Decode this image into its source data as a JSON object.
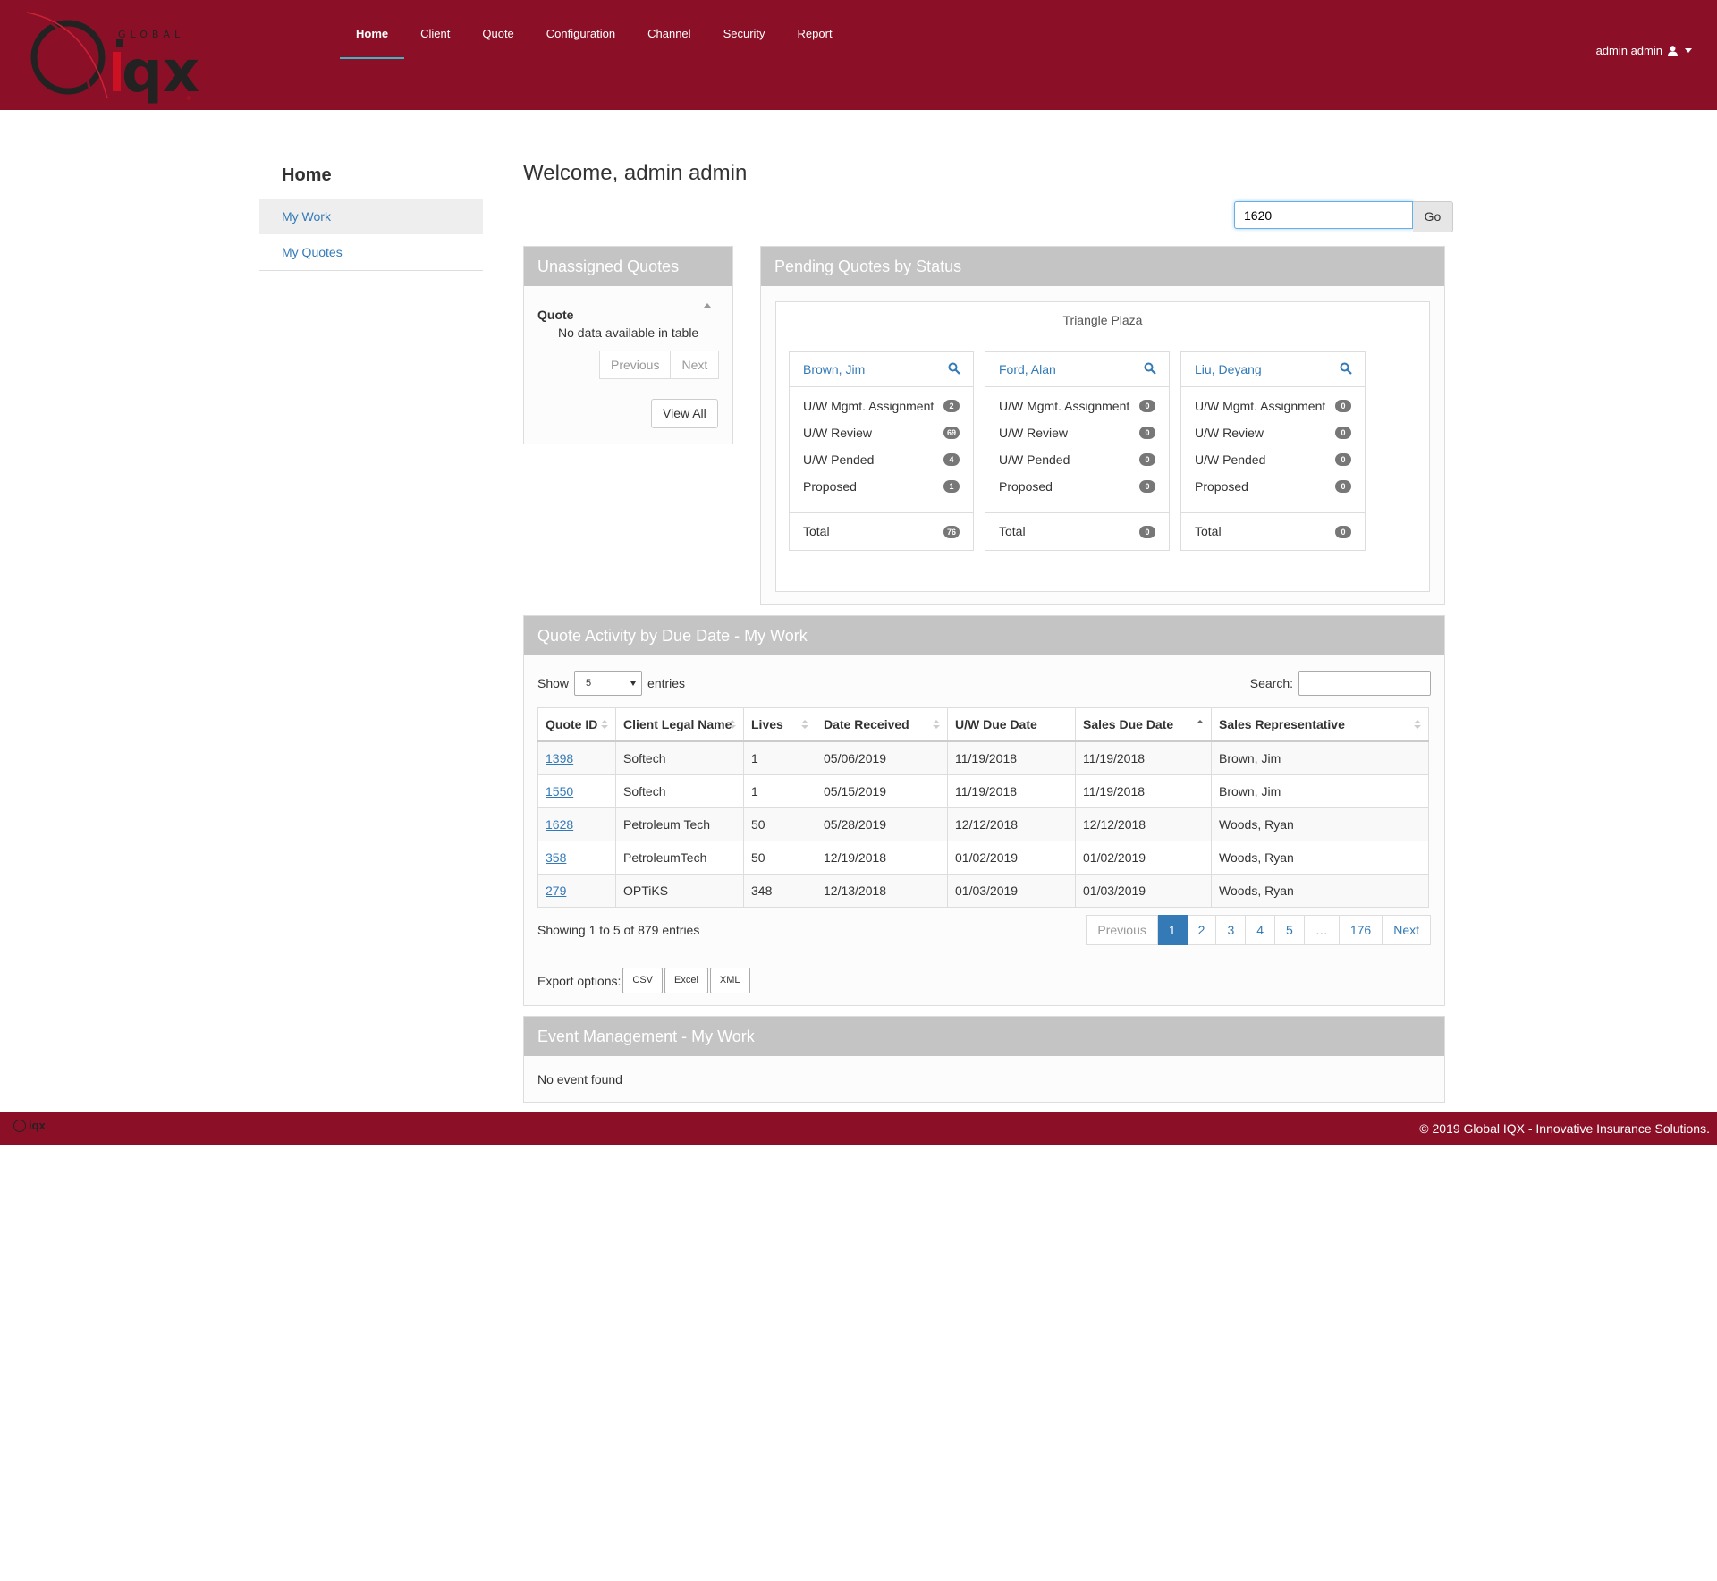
{
  "brand": {
    "logo_small": "GLOBAL",
    "logo_big": "iqx"
  },
  "nav": {
    "items": [
      "Home",
      "Client",
      "Quote",
      "Configuration",
      "Channel",
      "Security",
      "Report"
    ],
    "active": "Home",
    "user_label": "admin admin"
  },
  "sidebar": {
    "title": "Home",
    "items": [
      "My Work",
      "My Quotes"
    ]
  },
  "main": {
    "welcome": "Welcome, admin admin",
    "search_value": "1620",
    "go_label": "Go"
  },
  "unassigned": {
    "title": "Unassigned Quotes",
    "column": "Quote",
    "empty": "No data available in table",
    "prev": "Previous",
    "next": "Next",
    "view_all": "View All"
  },
  "pending": {
    "title": "Pending Quotes by Status",
    "group": "Triangle Plaza",
    "row_labels": [
      "U/W Mgmt. Assignment",
      "U/W Review",
      "U/W Pended",
      "Proposed"
    ],
    "total_label": "Total",
    "cards": [
      {
        "name": "Brown, Jim",
        "counts": [
          "2",
          "69",
          "4",
          "1"
        ],
        "total": "76"
      },
      {
        "name": "Ford, Alan",
        "counts": [
          "0",
          "0",
          "0",
          "0"
        ],
        "total": "0"
      },
      {
        "name": "Liu, Deyang",
        "counts": [
          "0",
          "0",
          "0",
          "0"
        ],
        "total": "0"
      }
    ]
  },
  "activity": {
    "title": "Quote Activity by Due Date - My Work",
    "show_label": "Show",
    "entries_label": "entries",
    "page_size": "5",
    "search_label": "Search:",
    "columns": [
      "Quote ID",
      "Client Legal Name",
      "Lives",
      "Date Received",
      "U/W Due Date",
      "Sales Due Date",
      "Sales Representative"
    ],
    "rows": [
      [
        "1398",
        "Softech",
        "1",
        "05/06/2019",
        "11/19/2018",
        "11/19/2018",
        "Brown, Jim"
      ],
      [
        "1550",
        "Softech",
        "1",
        "05/15/2019",
        "11/19/2018",
        "11/19/2018",
        "Brown, Jim"
      ],
      [
        "1628",
        "Petroleum Tech",
        "50",
        "05/28/2019",
        "12/12/2018",
        "12/12/2018",
        "Woods, Ryan"
      ],
      [
        "358",
        "PetroleumTech",
        "50",
        "12/19/2018",
        "01/02/2019",
        "01/02/2019",
        "Woods, Ryan"
      ],
      [
        "279",
        "OPTiKS",
        "348",
        "12/13/2018",
        "01/03/2019",
        "01/03/2019",
        "Woods, Ryan"
      ]
    ],
    "info": "Showing 1 to 5 of 879 entries",
    "pagination": [
      "Previous",
      "1",
      "2",
      "3",
      "4",
      "5",
      "…",
      "176",
      "Next"
    ],
    "export_label": "Export options:",
    "export_buttons": [
      "CSV",
      "Excel",
      "XML"
    ]
  },
  "events": {
    "title": "Event Management - My Work",
    "empty": "No event found"
  },
  "footer": {
    "logo": "iqx",
    "copyright": "© 2019 Global IQX - Innovative Insurance Solutions."
  },
  "colors": {
    "brand": "#8b1027",
    "panel_header": "#c4c4c4",
    "link": "#337ab7",
    "badge": "#777777"
  }
}
